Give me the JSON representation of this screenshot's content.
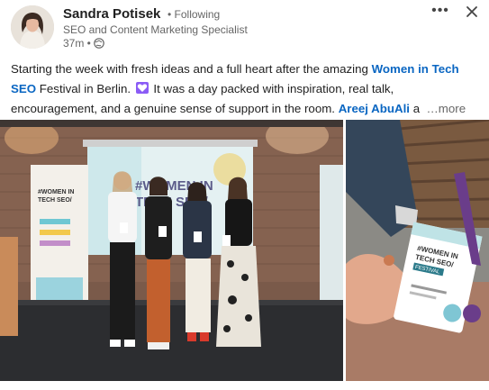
{
  "post": {
    "author_name": "Sandra Potisek",
    "follow_status": "• Following",
    "headline": "SEO and Content Marketing Specialist",
    "time": "37m •",
    "text_part1": "Starting the week with fresh ideas and a full heart after the amazing ",
    "link_event": "Women in Tech SEO",
    "text_part2": " Festival in Berlin. ",
    "text_part3": " It was a day packed with inspiration, real talk, encouragement, and a genuine sense of support in the room. ",
    "link_person": "Areej AbuAli",
    "text_part4": " a",
    "see_more": "…more"
  },
  "images": {
    "main_banner_text": "#WOMEN IN TECH SEO/",
    "main_screen_text": "#WOMEN IN TECH SEO/",
    "badge_text": "#WOMEN IN TECH SEO/",
    "badge_sub": "FESTIVAL"
  },
  "colors": {
    "link": "#0a66c2",
    "heart": "#8b5cf6",
    "secondary_text": "#666666"
  },
  "icons": {
    "more": "ellipsis-icon",
    "close": "close-icon",
    "globe": "globe-icon",
    "heart": "purple-heart-icon"
  }
}
